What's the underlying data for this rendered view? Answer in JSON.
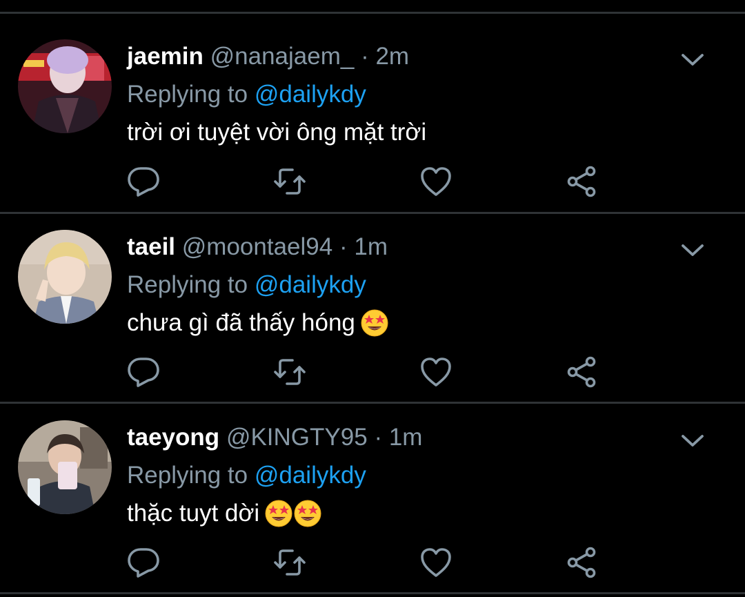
{
  "colors": {
    "background": "#000000",
    "divider": "#2f3336",
    "secondary_text": "#8899a6",
    "mention": "#1da1f2",
    "primary_text": "#ffffff"
  },
  "tweets": [
    {
      "name": "jaemin",
      "handle": "@nanajaem_",
      "separator": "·",
      "time": "2m",
      "replying_prefix": "Replying to",
      "replying_to": "@dailykdy",
      "text": "trời ơi tuyệt vời ông mặt trời",
      "emoji_count": 0,
      "icons": [
        "reply-icon",
        "retweet-icon",
        "like-icon",
        "share-icon",
        "chevron-down-icon"
      ]
    },
    {
      "name": "taeil",
      "handle": "@moontael94",
      "separator": "·",
      "time": "1m",
      "replying_prefix": "Replying to",
      "replying_to": "@dailykdy",
      "text": "chưa gì đã thấy hóng",
      "emoji_count": 1,
      "icons": [
        "reply-icon",
        "retweet-icon",
        "like-icon",
        "share-icon",
        "chevron-down-icon"
      ]
    },
    {
      "name": "taeyong",
      "handle": "@KINGTY95",
      "separator": "·",
      "time": "1m",
      "replying_prefix": "Replying to",
      "replying_to": "@dailykdy",
      "text": "thặc tuyt dời",
      "emoji_count": 2,
      "icons": [
        "reply-icon",
        "retweet-icon",
        "like-icon",
        "share-icon",
        "chevron-down-icon"
      ]
    }
  ]
}
